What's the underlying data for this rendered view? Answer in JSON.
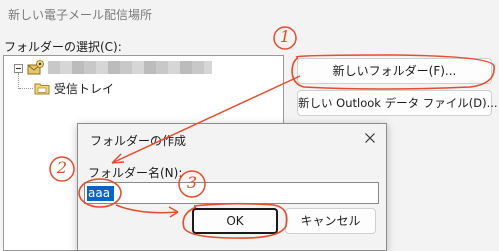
{
  "window": {
    "title": "新しい電子メール配信場所"
  },
  "folder_select": {
    "label": "フォルダーの選択(C):",
    "tree": {
      "child_folder": "受信トレイ"
    }
  },
  "buttons": {
    "new_folder": "新しいフォルダー(F)...",
    "new_data_file": "新しい Outlook データ ファイル(D)..."
  },
  "dialog": {
    "title": "フォルダーの作成",
    "name_label": "フォルダー名(N):",
    "name_value": "aaa",
    "ok": "OK",
    "cancel": "キャンセル"
  },
  "annotations": {
    "step1": "1",
    "step2": "2",
    "step3": "3",
    "color": "#e74c2c"
  },
  "icons": [
    "account-icon",
    "folder-icon",
    "close-icon"
  ]
}
